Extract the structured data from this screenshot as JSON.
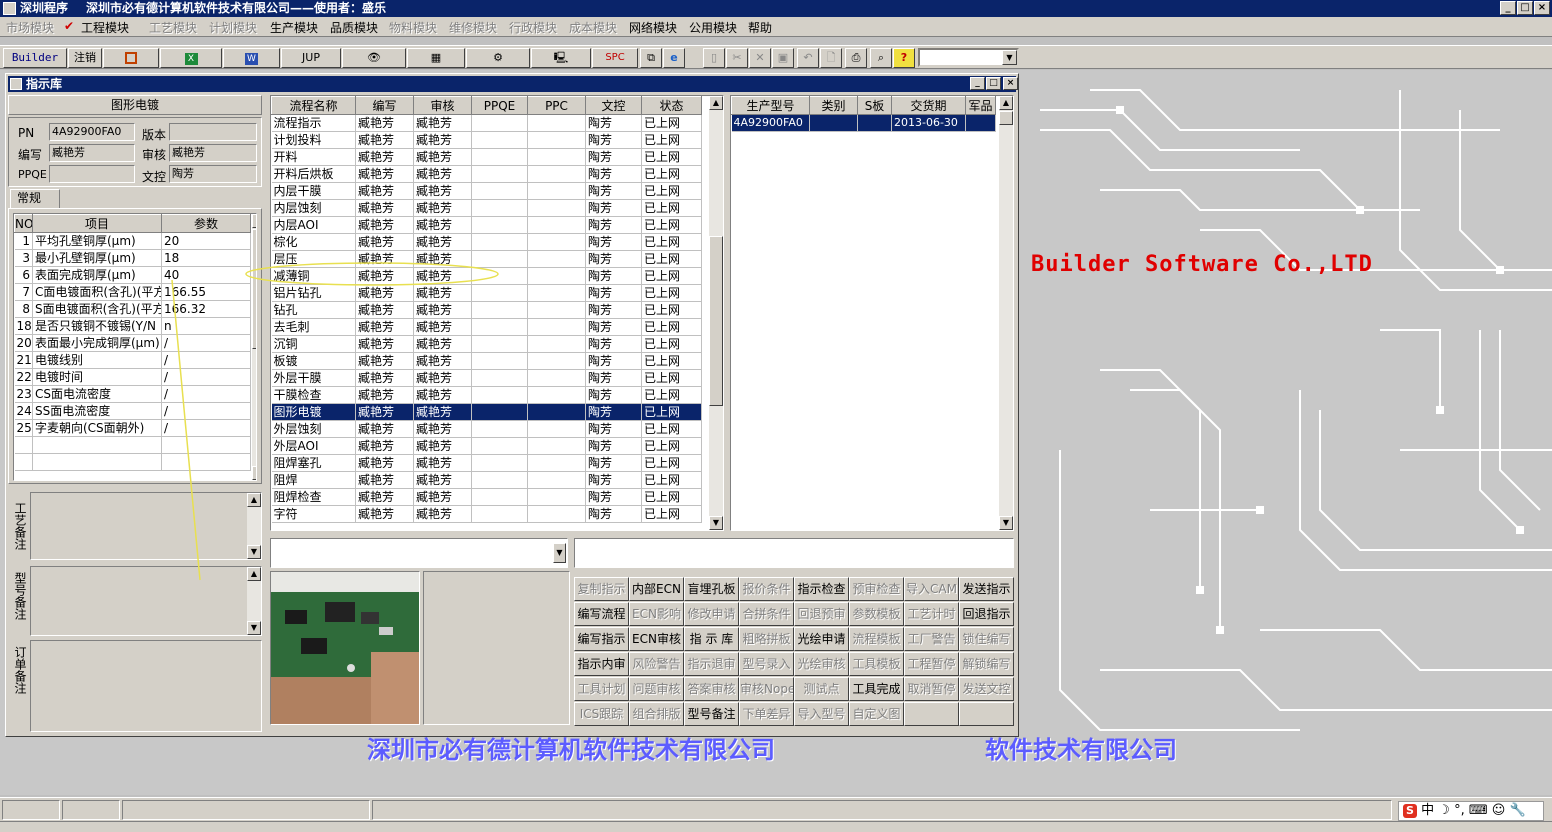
{
  "app": {
    "title": "深圳程序",
    "company": "深圳市必有德计算机软件技术有限公司——使用者：盛乐"
  },
  "menu": [
    {
      "label": "市场模块",
      "enabled": false
    },
    {
      "label": "工程模块",
      "enabled": true,
      "checked": true
    },
    {
      "label": "工艺模块",
      "enabled": false
    },
    {
      "label": "计划模块",
      "enabled": false
    },
    {
      "label": "生产模块",
      "enabled": true
    },
    {
      "label": "品质模块",
      "enabled": true
    },
    {
      "label": "物料模块",
      "enabled": false
    },
    {
      "label": "维修模块",
      "enabled": false
    },
    {
      "label": "行政模块",
      "enabled": false
    },
    {
      "label": "成本模块",
      "enabled": false
    },
    {
      "label": "网络模块",
      "enabled": true
    },
    {
      "label": "公用模块",
      "enabled": true
    },
    {
      "label": "帮助",
      "enabled": true
    }
  ],
  "toolbar": {
    "builder": "Builder",
    "logout": "注销",
    "jup": "JUP",
    "spc": "SPC"
  },
  "brand_text": "Builder Software Co.,LTD",
  "banner": {
    "left": "深圳市必有德计算机软件技术有限公司",
    "right": "软件技术有限公司"
  },
  "window": {
    "title": "指示库"
  },
  "left": {
    "section_title": "图形电镀",
    "pn_label": "PN",
    "pn_value": "4A92900FA0",
    "version_label": "版本",
    "version_value": "",
    "writer_label": "编写",
    "writer_value": "臧艳芳",
    "auditor_label": "审核",
    "auditor_value": "臧艳芳",
    "ppqe_label": "PPQE",
    "ppqe_value": "",
    "control_label": "文控",
    "control_value": "陶芳",
    "tab": "常规",
    "grid_headers": [
      "NO",
      "项目",
      "参数"
    ],
    "rows": [
      {
        "no": "1",
        "item": "平均孔壁铜厚(μm)",
        "param": "20"
      },
      {
        "no": "3",
        "item": "最小孔壁铜厚(μm)",
        "param": "18"
      },
      {
        "no": "6",
        "item": "表面完成铜厚(μm)",
        "param": "40"
      },
      {
        "no": "7",
        "item": "C面电镀面积(含孔)(平方",
        "param": "166.55"
      },
      {
        "no": "8",
        "item": "S面电镀面积(含孔)(平方",
        "param": "166.32"
      },
      {
        "no": "18",
        "item": "是否只镀铜不镀锡(Y/N",
        "param": "n"
      },
      {
        "no": "20",
        "item": "表面最小完成铜厚(μm)",
        "param": "/"
      },
      {
        "no": "21",
        "item": "电镀线别",
        "param": "/"
      },
      {
        "no": "22",
        "item": "电镀时间",
        "param": "/"
      },
      {
        "no": "23",
        "item": "CS面电流密度",
        "param": "/"
      },
      {
        "no": "24",
        "item": "SS面电流密度",
        "param": "/"
      },
      {
        "no": "25",
        "item": "字麦朝向(CS面朝外)",
        "param": "/"
      }
    ],
    "memo1_label": "工艺备注",
    "memo2_label": "型号备注",
    "memo3_label": "订单备注"
  },
  "flow": {
    "headers": [
      "流程名称",
      "编写",
      "审核",
      "PPQE",
      "PPC",
      "文控",
      "状态"
    ],
    "rows": [
      {
        "name": "流程指示",
        "writer": "臧艳芳",
        "auditor": "臧艳芳",
        "ppqe": "",
        "ppc": "",
        "control": "陶芳",
        "status": "已上网"
      },
      {
        "name": "计划投料",
        "writer": "臧艳芳",
        "auditor": "臧艳芳",
        "ppqe": "",
        "ppc": "",
        "control": "陶芳",
        "status": "已上网"
      },
      {
        "name": "开料",
        "writer": "臧艳芳",
        "auditor": "臧艳芳",
        "ppqe": "",
        "ppc": "",
        "control": "陶芳",
        "status": "已上网"
      },
      {
        "name": "开料后烘板",
        "writer": "臧艳芳",
        "auditor": "臧艳芳",
        "ppqe": "",
        "ppc": "",
        "control": "陶芳",
        "status": "已上网"
      },
      {
        "name": "内层干膜",
        "writer": "臧艳芳",
        "auditor": "臧艳芳",
        "ppqe": "",
        "ppc": "",
        "control": "陶芳",
        "status": "已上网"
      },
      {
        "name": "内层蚀刻",
        "writer": "臧艳芳",
        "auditor": "臧艳芳",
        "ppqe": "",
        "ppc": "",
        "control": "陶芳",
        "status": "已上网"
      },
      {
        "name": "内层AOI",
        "writer": "臧艳芳",
        "auditor": "臧艳芳",
        "ppqe": "",
        "ppc": "",
        "control": "陶芳",
        "status": "已上网"
      },
      {
        "name": "棕化",
        "writer": "臧艳芳",
        "auditor": "臧艳芳",
        "ppqe": "",
        "ppc": "",
        "control": "陶芳",
        "status": "已上网"
      },
      {
        "name": "层压",
        "writer": "臧艳芳",
        "auditor": "臧艳芳",
        "ppqe": "",
        "ppc": "",
        "control": "陶芳",
        "status": "已上网"
      },
      {
        "name": "减薄铜",
        "writer": "臧艳芳",
        "auditor": "臧艳芳",
        "ppqe": "",
        "ppc": "",
        "control": "陶芳",
        "status": "已上网"
      },
      {
        "name": "铝片钻孔",
        "writer": "臧艳芳",
        "auditor": "臧艳芳",
        "ppqe": "",
        "ppc": "",
        "control": "陶芳",
        "status": "已上网"
      },
      {
        "name": "钻孔",
        "writer": "臧艳芳",
        "auditor": "臧艳芳",
        "ppqe": "",
        "ppc": "",
        "control": "陶芳",
        "status": "已上网"
      },
      {
        "name": "去毛刺",
        "writer": "臧艳芳",
        "auditor": "臧艳芳",
        "ppqe": "",
        "ppc": "",
        "control": "陶芳",
        "status": "已上网"
      },
      {
        "name": "沉铜",
        "writer": "臧艳芳",
        "auditor": "臧艳芳",
        "ppqe": "",
        "ppc": "",
        "control": "陶芳",
        "status": "已上网"
      },
      {
        "name": "板镀",
        "writer": "臧艳芳",
        "auditor": "臧艳芳",
        "ppqe": "",
        "ppc": "",
        "control": "陶芳",
        "status": "已上网"
      },
      {
        "name": "外层干膜",
        "writer": "臧艳芳",
        "auditor": "臧艳芳",
        "ppqe": "",
        "ppc": "",
        "control": "陶芳",
        "status": "已上网"
      },
      {
        "name": "干膜检查",
        "writer": "臧艳芳",
        "auditor": "臧艳芳",
        "ppqe": "",
        "ppc": "",
        "control": "陶芳",
        "status": "已上网"
      },
      {
        "name": "图形电镀",
        "writer": "臧艳芳",
        "auditor": "臧艳芳",
        "ppqe": "",
        "ppc": "",
        "control": "陶芳",
        "status": "已上网",
        "selected": true
      },
      {
        "name": "外层蚀刻",
        "writer": "臧艳芳",
        "auditor": "臧艳芳",
        "ppqe": "",
        "ppc": "",
        "control": "陶芳",
        "status": "已上网"
      },
      {
        "name": "外层AOI",
        "writer": "臧艳芳",
        "auditor": "臧艳芳",
        "ppqe": "",
        "ppc": "",
        "control": "陶芳",
        "status": "已上网"
      },
      {
        "name": "阻焊塞孔",
        "writer": "臧艳芳",
        "auditor": "臧艳芳",
        "ppqe": "",
        "ppc": "",
        "control": "陶芳",
        "status": "已上网"
      },
      {
        "name": "阻焊",
        "writer": "臧艳芳",
        "auditor": "臧艳芳",
        "ppqe": "",
        "ppc": "",
        "control": "陶芳",
        "status": "已上网"
      },
      {
        "name": "阻焊检查",
        "writer": "臧艳芳",
        "auditor": "臧艳芳",
        "ppqe": "",
        "ppc": "",
        "control": "陶芳",
        "status": "已上网"
      },
      {
        "name": "字符",
        "writer": "臧艳芳",
        "auditor": "臧艳芳",
        "ppqe": "",
        "ppc": "",
        "control": "陶芳",
        "status": "已上网"
      }
    ]
  },
  "models": {
    "headers": [
      "生产型号",
      "类别",
      "S板",
      "交货期",
      "军品"
    ],
    "rows": [
      {
        "model": "4A92900FA0",
        "category": "",
        "sboard": "",
        "delivery": "2013-06-30",
        "military": ""
      }
    ]
  },
  "buttons": [
    {
      "label": "复制指示",
      "enabled": false
    },
    {
      "label": "内部ECN",
      "enabled": true
    },
    {
      "label": "盲埋孔板",
      "enabled": true
    },
    {
      "label": "报价条件",
      "enabled": false
    },
    {
      "label": "指示检查",
      "enabled": true
    },
    {
      "label": "预审检查",
      "enabled": false
    },
    {
      "label": "导入CAM",
      "enabled": false
    },
    {
      "label": "发送指示",
      "enabled": true
    },
    {
      "label": "编写流程",
      "enabled": true
    },
    {
      "label": "ECN影响",
      "enabled": false
    },
    {
      "label": "修改申请",
      "enabled": false
    },
    {
      "label": "合拼条件",
      "enabled": false
    },
    {
      "label": "回退预审",
      "enabled": false
    },
    {
      "label": "参数模板",
      "enabled": false
    },
    {
      "label": "工艺计时",
      "enabled": false
    },
    {
      "label": "回退指示",
      "enabled": true
    },
    {
      "label": "编写指示",
      "enabled": true
    },
    {
      "label": "ECN审核",
      "enabled": true
    },
    {
      "label": "指 示 库",
      "enabled": true
    },
    {
      "label": "粗略拼板",
      "enabled": false
    },
    {
      "label": "光绘申请",
      "enabled": true
    },
    {
      "label": "流程模板",
      "enabled": false
    },
    {
      "label": "工厂警告",
      "enabled": false
    },
    {
      "label": "锁住编写",
      "enabled": false
    },
    {
      "label": "指示内审",
      "enabled": true
    },
    {
      "label": "风险警告",
      "enabled": false
    },
    {
      "label": "指示退审",
      "enabled": false
    },
    {
      "label": "型号录入",
      "enabled": false
    },
    {
      "label": "光绘审核",
      "enabled": false
    },
    {
      "label": "工具模板",
      "enabled": false
    },
    {
      "label": "工程暂停",
      "enabled": false
    },
    {
      "label": "解锁编写",
      "enabled": false
    },
    {
      "label": "工具计划",
      "enabled": false
    },
    {
      "label": "问题审核",
      "enabled": false
    },
    {
      "label": "答案审核",
      "enabled": false
    },
    {
      "label": "审核Nope",
      "enabled": false
    },
    {
      "label": "测试点",
      "enabled": false
    },
    {
      "label": "工具完成",
      "enabled": true
    },
    {
      "label": "取消暂停",
      "enabled": false
    },
    {
      "label": "发送文控",
      "enabled": false
    },
    {
      "label": "ICS跟踪",
      "enabled": false
    },
    {
      "label": "组合排版",
      "enabled": false
    },
    {
      "label": "型号备注",
      "enabled": true
    },
    {
      "label": "下单差异",
      "enabled": false
    },
    {
      "label": "导入型号",
      "enabled": false
    },
    {
      "label": "自定义图",
      "enabled": false
    },
    {
      "label": "",
      "enabled": false
    },
    {
      "label": "",
      "enabled": false
    }
  ],
  "ime": {
    "lang": "中"
  },
  "colors": {
    "titlebar": "#0a246a",
    "face": "#d4d0c8",
    "brand": "#e00000",
    "banner": "#5c5cff",
    "annotation": "#e8e050"
  }
}
